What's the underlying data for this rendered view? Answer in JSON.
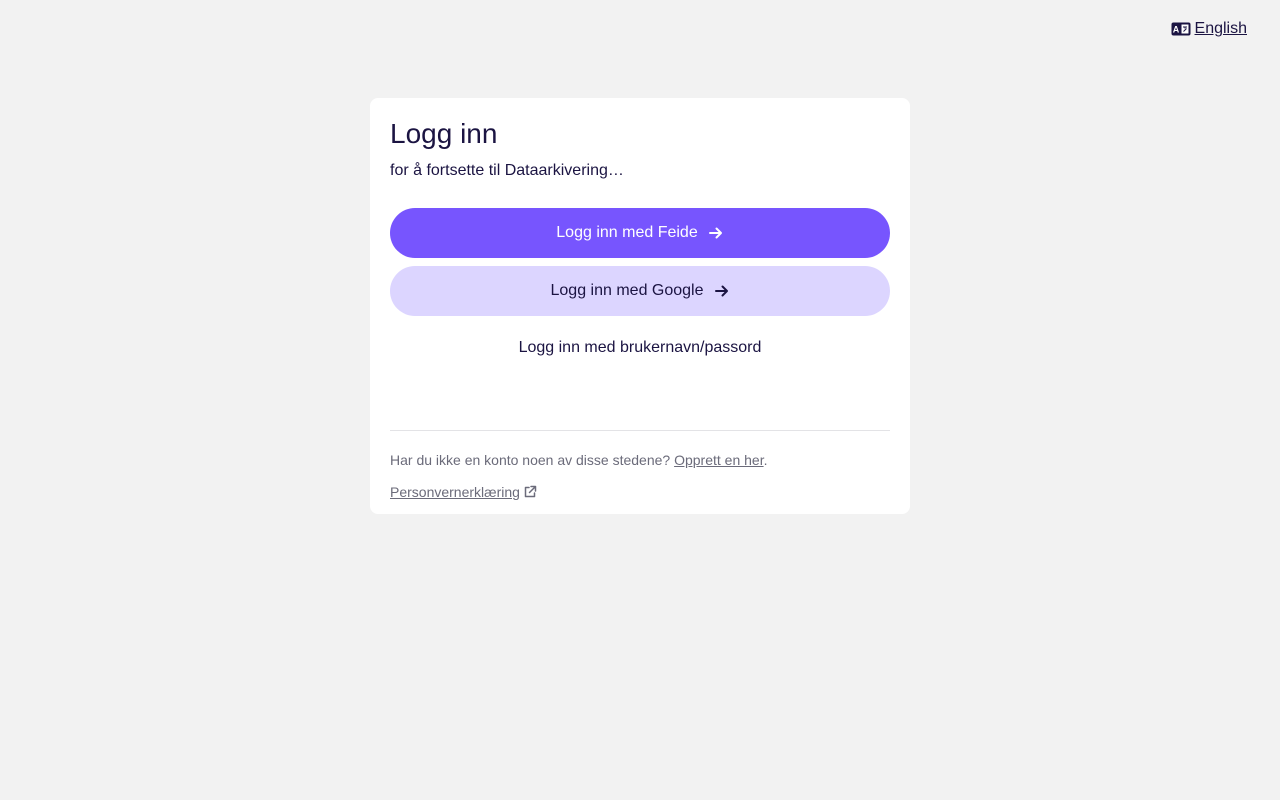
{
  "header": {
    "language_label": "English",
    "language_icon": "language-icon"
  },
  "login": {
    "title": "Logg inn",
    "subtitle": "for å fortsette til Dataarkivering…",
    "feide_button": "Logg inn med Feide",
    "google_button": "Logg inn med Google",
    "password_button": "Logg inn med brukernavn/passord",
    "no_account_text": "Har du ikke en konto noen av disse stedene?",
    "create_account_link": "Opprett en her",
    "create_account_suffix": ".",
    "privacy_link": "Personvernerklæring"
  },
  "colors": {
    "background": "#f2f2f2",
    "primary": "#7755fe",
    "secondary": "#dcd5ff",
    "text": "#1b1442",
    "muted": "#6b6b7a"
  }
}
